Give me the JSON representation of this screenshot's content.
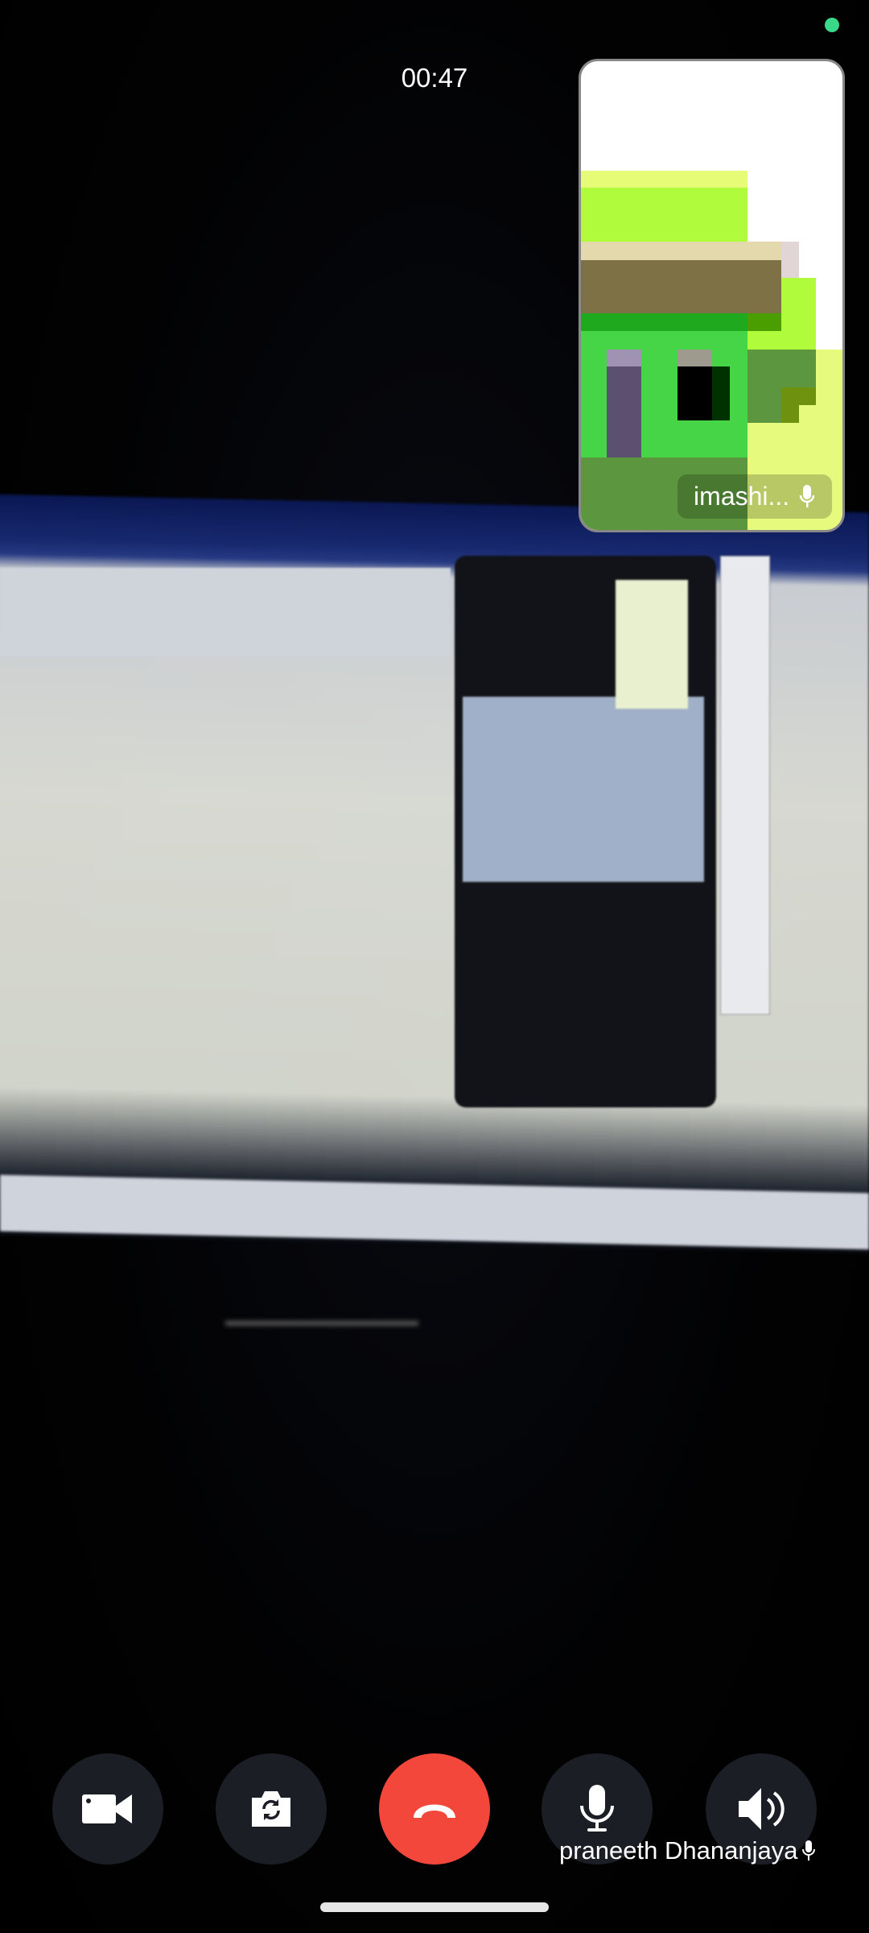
{
  "call": {
    "timer": "00:47",
    "status_dot_color": "#3ad98a",
    "remote_participant": "praneeth Dhananjaya",
    "self_view_label": "imashi..."
  },
  "controls": [
    {
      "name": "video",
      "icon": "video-camera-icon"
    },
    {
      "name": "switch-camera",
      "icon": "camera-flip-icon"
    },
    {
      "name": "end-call",
      "icon": "phone-hangup-icon",
      "color": "#f4473b"
    },
    {
      "name": "microphone",
      "icon": "microphone-icon"
    },
    {
      "name": "speaker",
      "icon": "speaker-icon"
    }
  ]
}
